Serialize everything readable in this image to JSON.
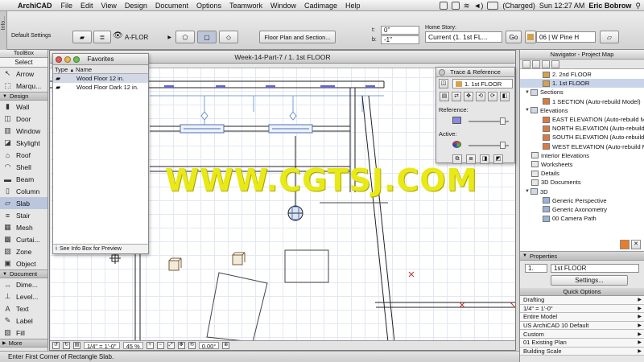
{
  "menubar": {
    "app_name": "ArchiCAD",
    "menus": [
      "File",
      "Edit",
      "View",
      "Design",
      "Document",
      "Options",
      "Teamwork",
      "Window",
      "Cadimage",
      "Help"
    ],
    "battery": "(Charged)",
    "clock": "Sun 12:27 AM",
    "user": "Eric Bobrow"
  },
  "infobox": {
    "tab_label": "Info...",
    "settings_label": "Default Settings",
    "layer": "A-FLOR",
    "view_button": "Floor Plan and Section...",
    "t_label": "t:",
    "b_label": "b:",
    "t_value": "0\"",
    "b_value": "-1\"",
    "home_story_label": "Home Story:",
    "home_story": "Current (1. 1st FL...",
    "go_button": "Go",
    "material": "06 | W Pine H"
  },
  "toolbox": {
    "title": "ToolBox",
    "select_label": "Select",
    "top_tools": [
      {
        "label": "Arrow",
        "icon": "arrow-icon"
      },
      {
        "label": "Marqu...",
        "icon": "marquee-icon"
      }
    ],
    "design_section": "Design",
    "design_tools": [
      {
        "label": "Wall",
        "icon": "wall-icon"
      },
      {
        "label": "Door",
        "icon": "door-icon"
      },
      {
        "label": "Window",
        "icon": "window-icon"
      },
      {
        "label": "Skylight",
        "icon": "skylight-icon"
      },
      {
        "label": "Roof",
        "icon": "roof-icon"
      },
      {
        "label": "Shell",
        "icon": "shell-icon"
      },
      {
        "label": "Beam",
        "icon": "beam-icon"
      },
      {
        "label": "Column",
        "icon": "column-icon"
      },
      {
        "label": "Slab",
        "icon": "slab-icon"
      },
      {
        "label": "Stair",
        "icon": "stair-icon"
      },
      {
        "label": "Mesh",
        "icon": "mesh-icon"
      },
      {
        "label": "Curtai...",
        "icon": "curtain-wall-icon"
      },
      {
        "label": "Zone",
        "icon": "zone-icon"
      },
      {
        "label": "Object",
        "icon": "object-icon"
      }
    ],
    "document_section": "Document",
    "document_tools": [
      {
        "label": "Dime...",
        "icon": "dimension-icon"
      },
      {
        "label": "Level...",
        "icon": "level-dimension-icon"
      },
      {
        "label": "Text",
        "icon": "text-icon"
      },
      {
        "label": "Label",
        "icon": "label-icon"
      },
      {
        "label": "Fill",
        "icon": "fill-icon"
      }
    ],
    "more_section": "More"
  },
  "drawing": {
    "title": "Week-14-Part-7 / 1. 1st FLOOR",
    "scale": "1/4\"  =  1'-0\"",
    "zoom": "45 %",
    "angle": "0.00°"
  },
  "favorites": {
    "title": "Favorites",
    "col_type": "Type",
    "col_name": "Name",
    "items": [
      "Wood Floor 12 in.",
      "Wood Floor Dark 12 in."
    ],
    "footer": "See Info Box for Preview"
  },
  "trace": {
    "title": "Trace & Reference",
    "story": "1. 1st FLOOR",
    "reference_label": "Reference:",
    "active_label": "Active:",
    "reference_level": 0.85,
    "active_level": 0.85
  },
  "navigator": {
    "title": "Navigator - Project Map",
    "items": [
      {
        "label": "2. 2nd FLOOR",
        "indent": 2,
        "icon": "story-icon"
      },
      {
        "label": "1. 1st FLOOR",
        "indent": 2,
        "icon": "story-icon",
        "selected": true
      },
      {
        "label": "Sections",
        "indent": 1,
        "icon": "folder-icon",
        "tri": "▼"
      },
      {
        "label": "1 SECTION (Auto-rebuild Model)",
        "indent": 2,
        "icon": "section-icon"
      },
      {
        "label": "Elevations",
        "indent": 1,
        "icon": "folder-icon",
        "tri": "▼"
      },
      {
        "label": "EAST ELEVATION (Auto-rebuild M",
        "indent": 2,
        "icon": "elevation-icon"
      },
      {
        "label": "NORTH ELEVATION (Auto-rebuild",
        "indent": 2,
        "icon": "elevation-icon"
      },
      {
        "label": "SOUTH ELEVATION (Auto-rebuild",
        "indent": 2,
        "icon": "elevation-icon"
      },
      {
        "label": "WEST ELEVATION (Auto-rebuild M",
        "indent": 2,
        "icon": "elevation-icon"
      },
      {
        "label": "Interior Elevations",
        "indent": 1,
        "icon": "interior-elevation-icon"
      },
      {
        "label": "Worksheets",
        "indent": 1,
        "icon": "worksheet-icon"
      },
      {
        "label": "Details",
        "indent": 1,
        "icon": "detail-icon"
      },
      {
        "label": "3D Documents",
        "indent": 1,
        "icon": "document-3d-icon"
      },
      {
        "label": "3D",
        "indent": 1,
        "icon": "folder-icon",
        "tri": "▼"
      },
      {
        "label": "Generic Perspective",
        "indent": 2,
        "icon": "perspective-icon"
      },
      {
        "label": "Generic Axonometry",
        "indent": 2,
        "icon": "axonometry-icon"
      },
      {
        "label": "00 Camera Path",
        "indent": 2,
        "icon": "camera-icon"
      }
    ]
  },
  "properties": {
    "header": "Properties",
    "number": "1.",
    "name": "1st FLOOR",
    "settings_button": "Settings..."
  },
  "quick_options": {
    "title": "Quick Options",
    "rows": [
      "Drafting",
      "1/4\"   =    1'-0\"",
      "Entire Model",
      "US ArchiCAD 10 Default",
      "Custom",
      "01 Existing Plan",
      "Building Scale"
    ]
  },
  "statusbar": {
    "message": "Enter First Corner of Rectangle Slab."
  },
  "watermark": {
    "text": "WWW.CGTSJ.COM"
  },
  "colors": {
    "selection": "#c8d4ea",
    "watermark": "#e9e915",
    "grid": "#e3e8f2",
    "marker": "#c03030",
    "window_blue": "#6666cc"
  }
}
